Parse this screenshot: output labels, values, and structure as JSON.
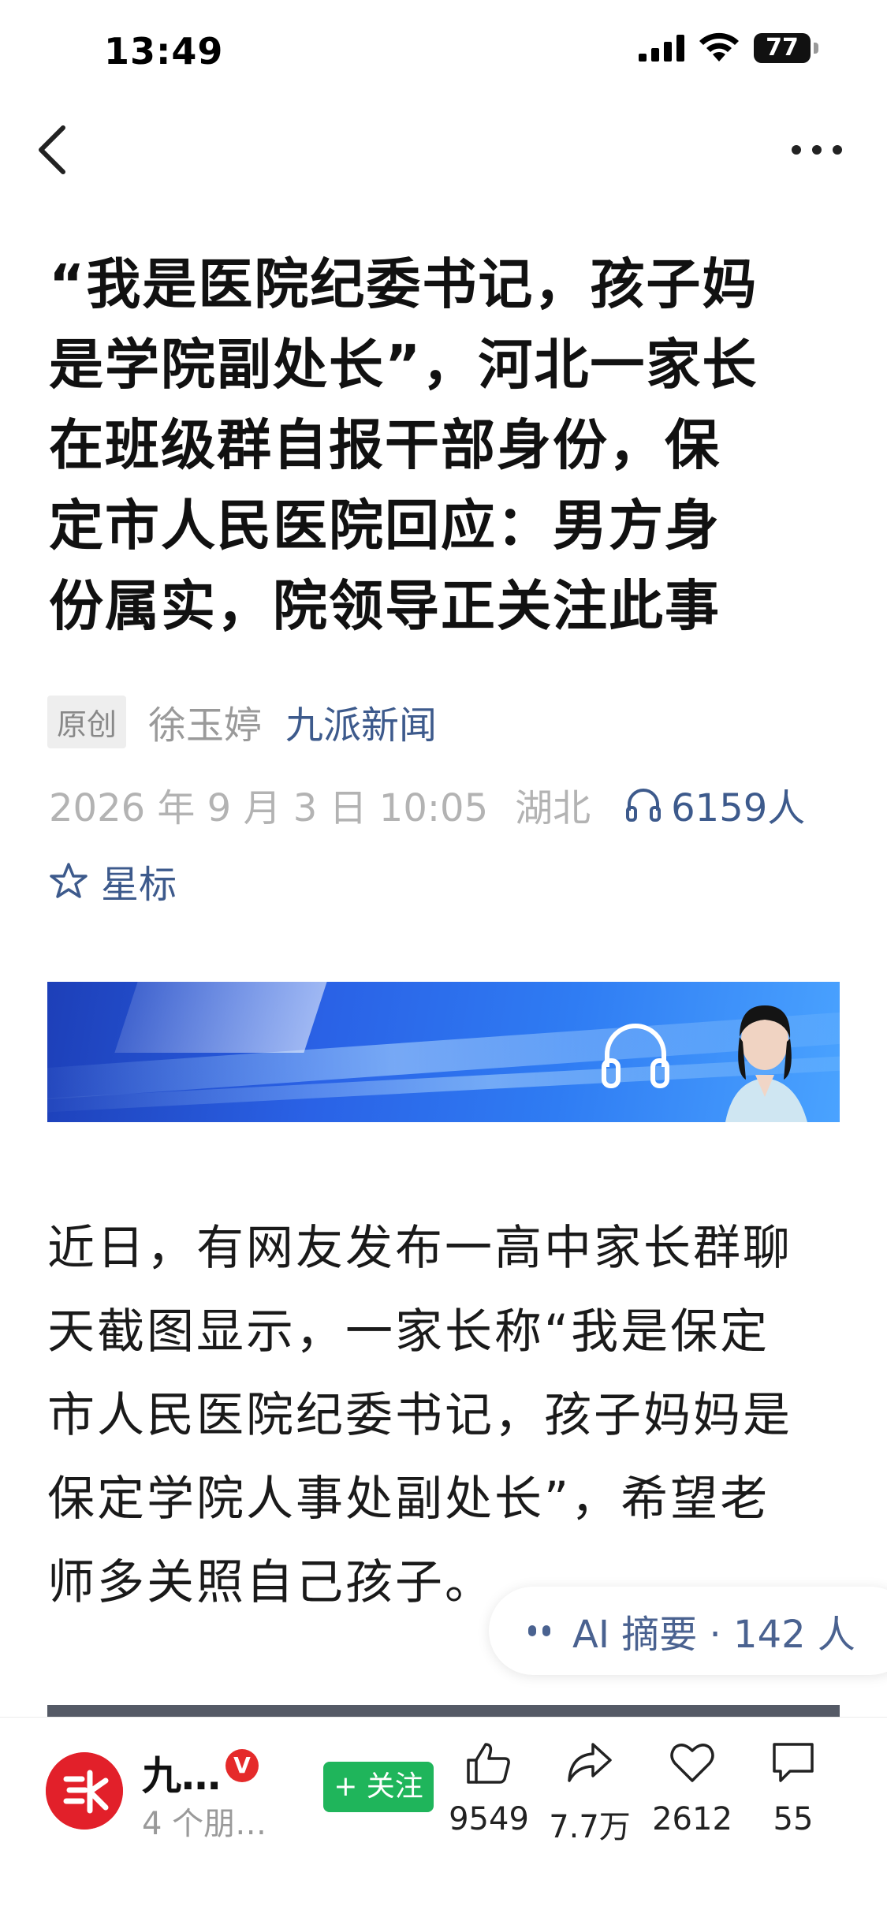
{
  "status_bar": {
    "time": "13:49",
    "battery": "77"
  },
  "nav": {
    "back_icon": "chevron-left-icon",
    "more_icon": "more-horizontal-icon"
  },
  "article": {
    "title_lines": [
      "“我是医院纪委书记，孩子妈",
      "是学院副处长”，河北一家长",
      "在班级群自报干部身份，保",
      "定市人民医院回应：男方身",
      "份属实，院领导正关注此事"
    ],
    "badge": "原创",
    "author": "徐玉婷",
    "source": "九派新闻",
    "date": "2026 年 9 月 3 日  10:05",
    "location": "湖北",
    "listeners": "6159人",
    "star_label": "星标",
    "paragraph_lines": [
      "近日，有网友发布一高中家长群聊",
      "天截图显示，一家长称“我是保定",
      "市人民医院纪委书记，孩子妈妈是",
      "保定学院人事处副处长”，希望老",
      "师多关照自己孩子。"
    ]
  },
  "ai_summary": {
    "label": "AI 摘要 · 142 人"
  },
  "bottom_bar": {
    "account_name": "九…",
    "account_sub": "4 个朋…",
    "verified_mark": "V",
    "follow_label": "+ 关注",
    "like_count": "9549",
    "share_count": "7.7万",
    "favorite_count": "2612",
    "comment_count": "55"
  },
  "colors": {
    "accent_blue": "#3d5a8c",
    "follow_green": "#1fb55b",
    "brand_red": "#e2202a"
  }
}
